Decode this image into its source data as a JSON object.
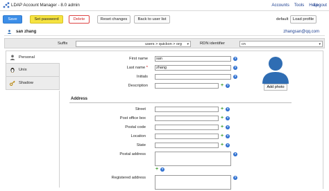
{
  "header": {
    "app_title": "LDAP Account Manager - 8.0",
    "user": "admin",
    "links": [
      "Accounts",
      "Tools",
      "Help"
    ],
    "logout": "Logout"
  },
  "toolbar": {
    "save_label": "Save",
    "set_password_label": "Set password",
    "delete_label": "Delete",
    "reset_label": "Reset changes",
    "back_label": "Back to user list",
    "profile_value": "default",
    "load_profile_label": "Load profile"
  },
  "account": {
    "name": "san zhang",
    "email": "zhangsan@qq.com"
  },
  "suffix": {
    "label": "Suffix",
    "value": "users > quickon > org",
    "rdn_label": "RDN identifier",
    "rdn_value": "cn"
  },
  "tabs": [
    {
      "label": "Personal",
      "icon": "person-icon"
    },
    {
      "label": "Unix",
      "icon": "tux-penguin-icon"
    },
    {
      "label": "Shadow",
      "icon": "key-icon"
    }
  ],
  "form": {
    "first_name_label": "First name",
    "first_name_value": "san",
    "last_name_label": "Last name",
    "last_name_required": "*",
    "last_name_value": "zhang",
    "initials_label": "Initials",
    "initials_value": "",
    "description_label": "Description",
    "description_value": "",
    "address_section": "Address",
    "street_label": "Street",
    "po_box_label": "Post office box",
    "postal_code_label": "Postal code",
    "location_label": "Location",
    "state_label": "State",
    "postal_address_label": "Postal address",
    "registered_address_label": "Registered address",
    "help_glyph": "?",
    "plus_glyph": "+"
  },
  "photo": {
    "add_label": "Add photo"
  },
  "colors": {
    "save": "#3c8ee8",
    "set_password": "#f6e340",
    "delete_border": "#dd4444",
    "help": "#2d6fd0",
    "link": "#1a3d8f",
    "avatar": "#2f6db3"
  }
}
